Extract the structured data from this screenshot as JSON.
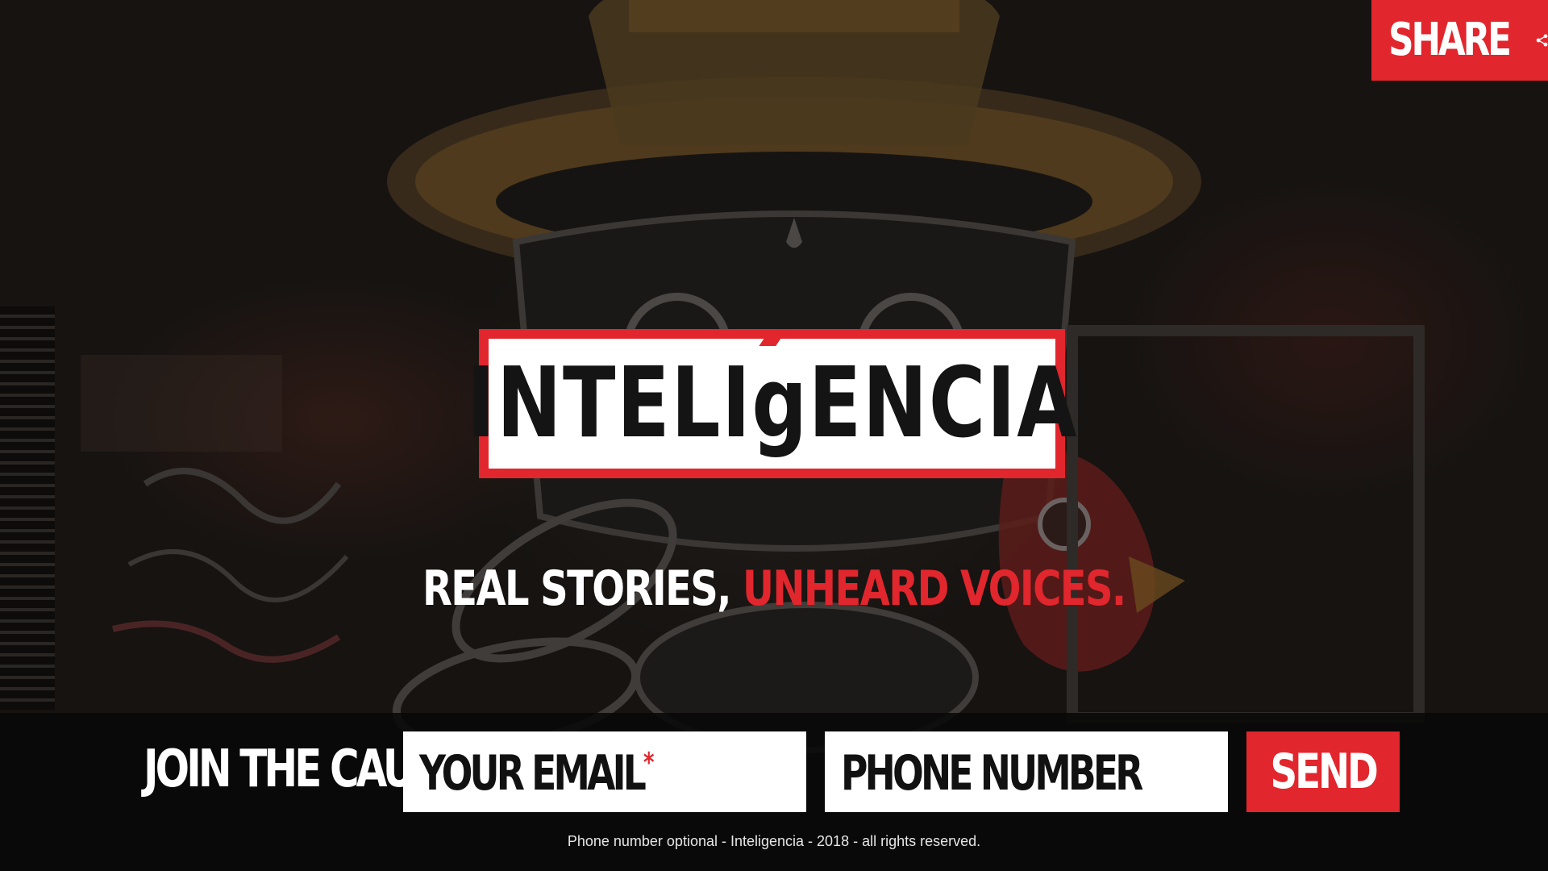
{
  "share": {
    "label": "SHARE",
    "icon": "share-icon"
  },
  "logo": {
    "text_before": "INTELI",
    "text_g": "g",
    "text_after": "ENCIA"
  },
  "tagline": {
    "white": "REAL STORIES, ",
    "red": "UNHEARD VOICES."
  },
  "signup": {
    "heading": "JOIN THE CAUSE",
    "email_placeholder": "YOUR EMAIL",
    "email_required_mark": "*",
    "phone_placeholder": "PHONE NUMBER",
    "send_label": "SEND",
    "footer_note": "Phone number optional - Inteligencia - 2018 - all rights reserved."
  },
  "colors": {
    "accent": "#e1262d",
    "background": "#1b1816",
    "bar": "#080808"
  }
}
